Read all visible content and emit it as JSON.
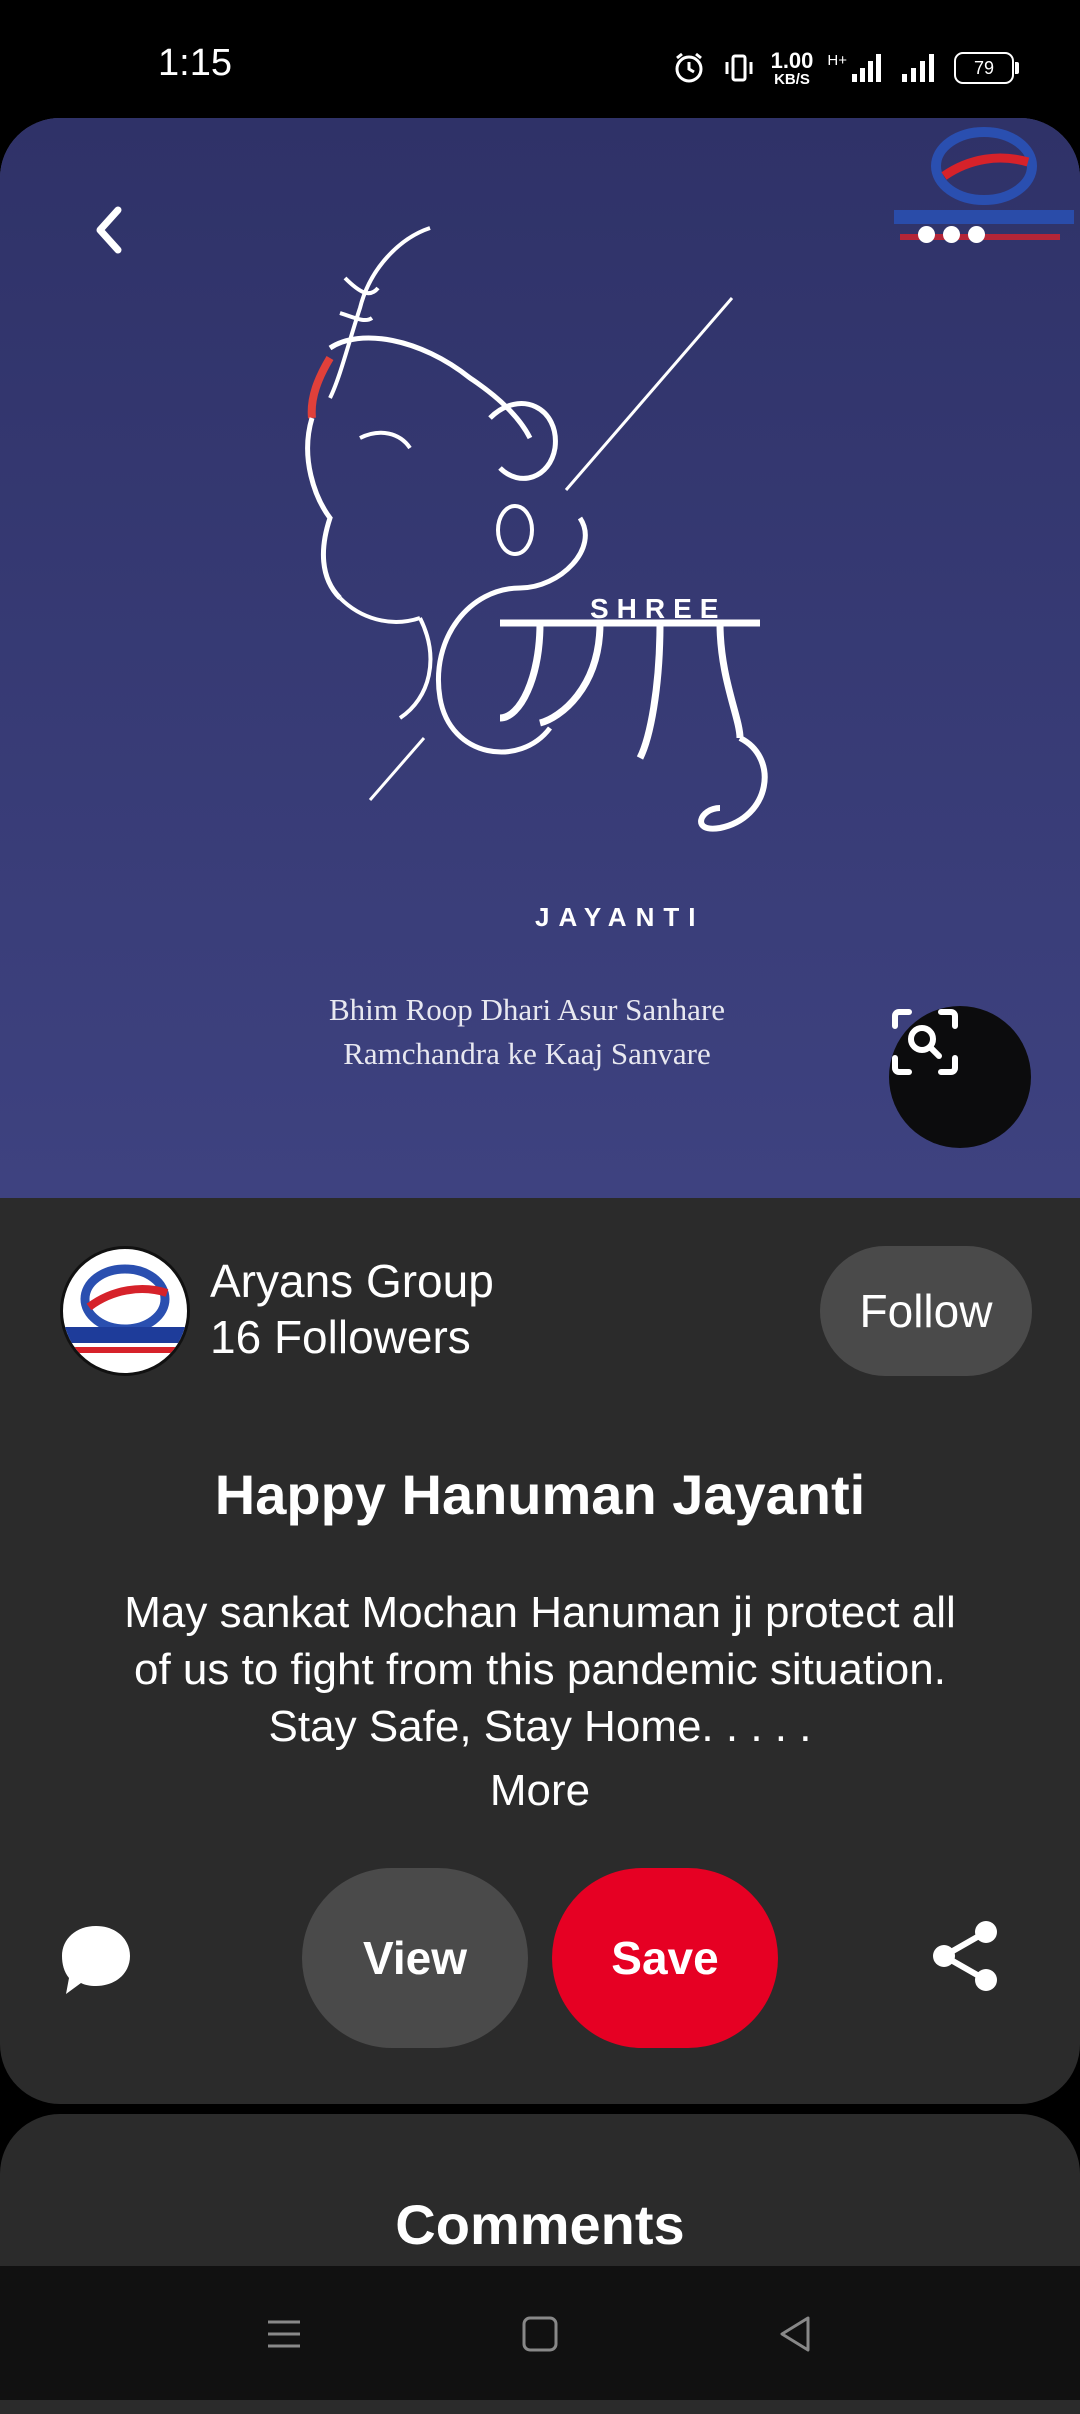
{
  "status_bar": {
    "time": "1:15",
    "net_speed_value": "1.00",
    "net_speed_unit": "KB/S",
    "network_type": "H+",
    "battery": "79"
  },
  "pin": {
    "image_script_title_top": "SHREE",
    "image_script_title_bottom": "JAYANTI",
    "image_caption_line1": "Bhim Roop Dhari Asur Sanhare",
    "image_caption_line2": "Ramchandra ke Kaaj Sanvare",
    "title": "Happy Hanuman Jayanti",
    "description": "May sankat Mochan Hanuman ji protect all of us to fight from this pandemic situation. Stay Safe, Stay Home. . . . .",
    "more_label": "More"
  },
  "creator": {
    "name": "Aryans Group",
    "followers": "16 Followers",
    "follow_label": "Follow"
  },
  "actions": {
    "view_label": "View",
    "save_label": "Save"
  },
  "comments": {
    "title": "Comments"
  },
  "colors": {
    "accent": "#e60023",
    "hero_bg": "#3b3f78",
    "card_bg": "#2b2b2b",
    "button_bg": "#4a4a4a"
  },
  "icons": {
    "back": "chevron-left-icon",
    "more": "more-dots-icon",
    "lens": "visual-search-icon",
    "comment": "speech-bubble-icon",
    "share": "share-icon",
    "nav_menu": "menu-icon",
    "nav_home": "square-home-icon",
    "nav_back": "triangle-back-icon"
  }
}
